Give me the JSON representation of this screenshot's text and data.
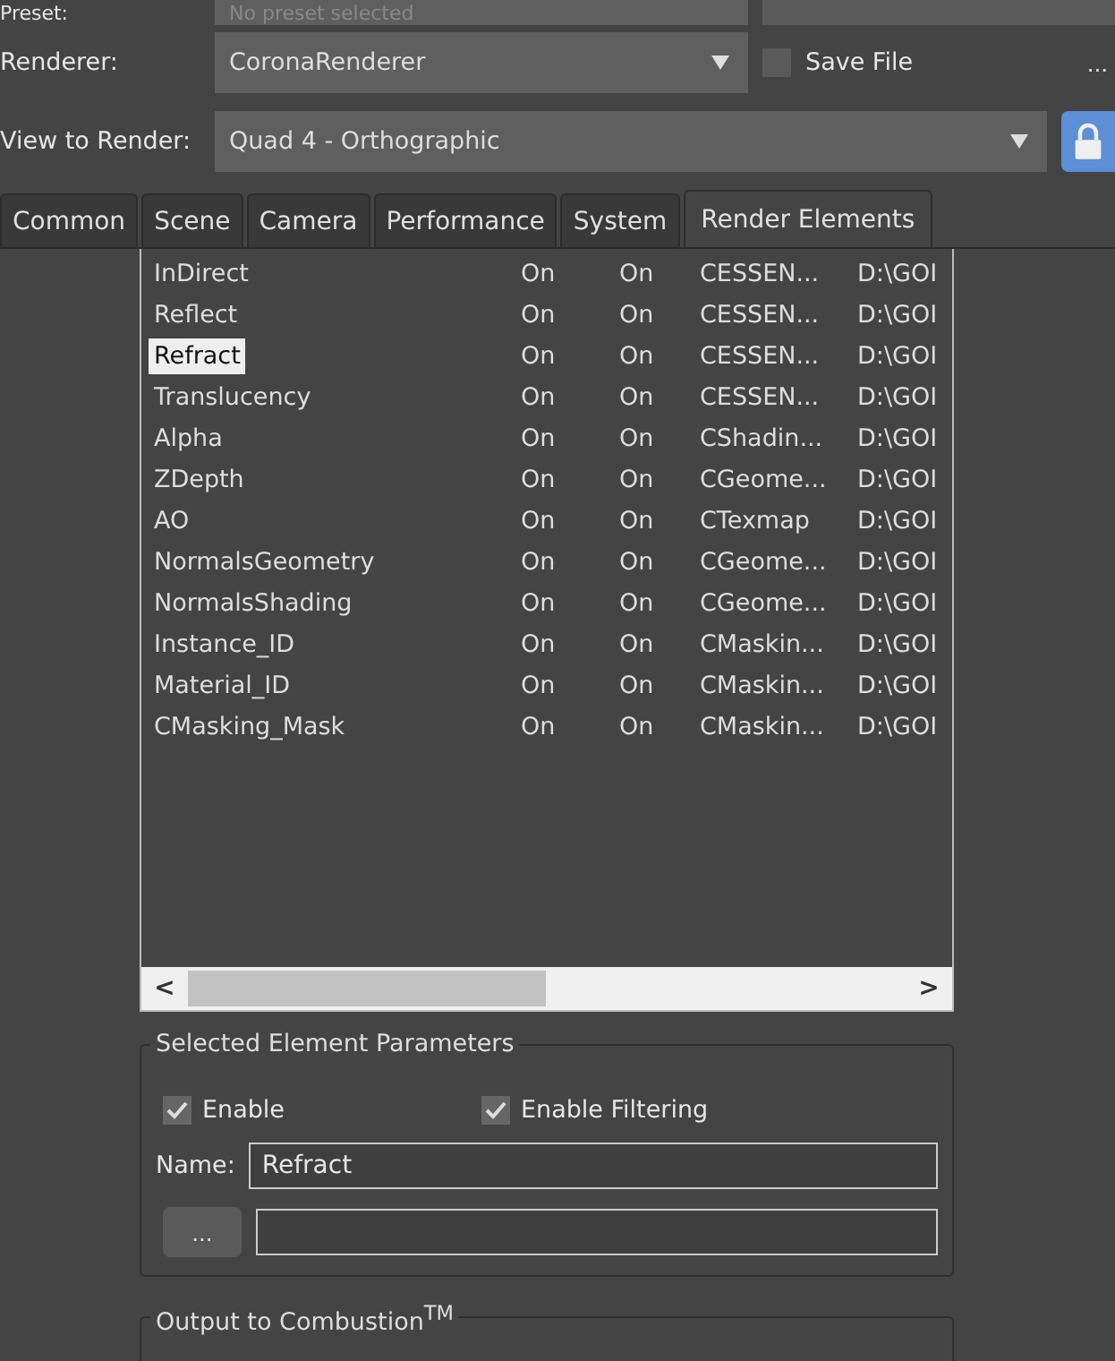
{
  "preset": {
    "label": "Preset:",
    "value": "No preset selected"
  },
  "renderer": {
    "label": "Renderer:",
    "value": "CoronaRenderer",
    "save_file": {
      "label": "Save File",
      "checked": false
    },
    "more": "..."
  },
  "view": {
    "label": "View to Render:",
    "value": "Quad 4 - Orthographic"
  },
  "tabs": [
    {
      "label": "Common",
      "selected": false
    },
    {
      "label": "Scene",
      "selected": false
    },
    {
      "label": "Camera",
      "selected": false
    },
    {
      "label": "Performance",
      "selected": false
    },
    {
      "label": "System",
      "selected": false
    },
    {
      "label": "Render Elements",
      "selected": true
    }
  ],
  "elements": [
    {
      "name": "InDirect",
      "enabled": "On",
      "filter": "On",
      "type": "CESSEN...",
      "path": "D:\\GOI",
      "selected": false
    },
    {
      "name": "Reflect",
      "enabled": "On",
      "filter": "On",
      "type": "CESSEN...",
      "path": "D:\\GOI",
      "selected": false
    },
    {
      "name": "Refract",
      "enabled": "On",
      "filter": "On",
      "type": "CESSEN...",
      "path": "D:\\GOI",
      "selected": true
    },
    {
      "name": "Translucency",
      "enabled": "On",
      "filter": "On",
      "type": "CESSEN...",
      "path": "D:\\GOI",
      "selected": false
    },
    {
      "name": "Alpha",
      "enabled": "On",
      "filter": "On",
      "type": "CShadin...",
      "path": "D:\\GOI",
      "selected": false
    },
    {
      "name": "ZDepth",
      "enabled": "On",
      "filter": "On",
      "type": "CGeome...",
      "path": "D:\\GOI",
      "selected": false
    },
    {
      "name": "AO",
      "enabled": "On",
      "filter": "On",
      "type": "CTexmap",
      "path": "D:\\GOI",
      "selected": false
    },
    {
      "name": "NormalsGeometry",
      "enabled": "On",
      "filter": "On",
      "type": "CGeome...",
      "path": "D:\\GOI",
      "selected": false
    },
    {
      "name": "NormalsShading",
      "enabled": "On",
      "filter": "On",
      "type": "CGeome...",
      "path": "D:\\GOI",
      "selected": false
    },
    {
      "name": "Instance_ID",
      "enabled": "On",
      "filter": "On",
      "type": "CMaskin...",
      "path": "D:\\GOI",
      "selected": false
    },
    {
      "name": "Material_ID",
      "enabled": "On",
      "filter": "On",
      "type": "CMaskin...",
      "path": "D:\\GOI",
      "selected": false
    },
    {
      "name": "CMasking_Mask",
      "enabled": "On",
      "filter": "On",
      "type": "CMaskin...",
      "path": "D:\\GOI",
      "selected": false
    }
  ],
  "scroll_left": "<",
  "scroll_right": ">",
  "selected_params": {
    "title": "Selected Element Parameters",
    "enable": {
      "label": "Enable",
      "checked": true
    },
    "enable_filtering": {
      "label": "Enable Filtering",
      "checked": true
    },
    "name_label": "Name:",
    "name_value": "Refract",
    "browse": "..."
  },
  "output": {
    "title": "Output to  Combustion$^{TM}$"
  }
}
